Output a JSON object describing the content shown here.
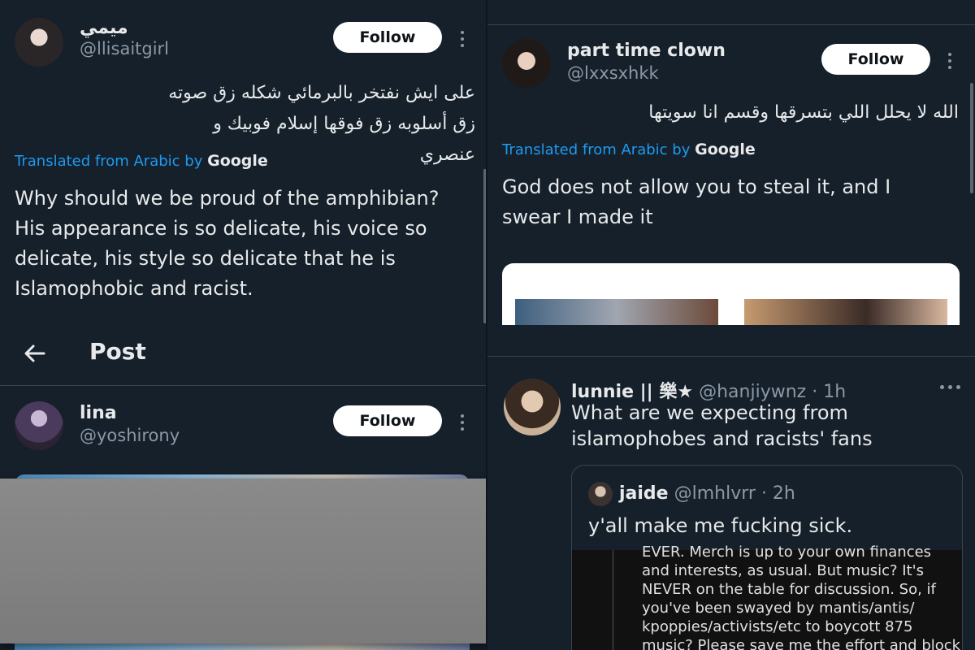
{
  "tweet1": {
    "name": "ميمي",
    "handle": "@llisaitgirl",
    "follow": "Follow",
    "arabic": "على ايش نفتخر بالبرمائي شكله زق صوته زق أسلوبه زق فوقها إسلام فوبيك و عنصري",
    "translated_prefix": "Translated from Arabic by",
    "translated_brand": "Google",
    "english": "Why should we be proud of the amphibian? His appearance is so delicate, his voice so delicate, his style so delicate that he is Islamophobic and racist."
  },
  "header": {
    "title": "Post"
  },
  "tweet2": {
    "name": "lina",
    "handle": "@yoshirony",
    "follow": "Follow"
  },
  "tweet3": {
    "name": "part time clown",
    "handle": "@lxxsxhkk",
    "follow": "Follow",
    "arabic": "الله لا يحلل اللي بتسرقها وقسم انا سويتها",
    "translated_prefix": "Translated from Arabic by",
    "translated_brand": "Google",
    "english": "God does not allow you to steal it, and I swear I made it"
  },
  "tweet4": {
    "name": "lunnie || 樂★",
    "handle": "@hanjiywnz",
    "time": "· 1h",
    "text": "What are we expecting from islamophobes and racists' fans",
    "quote": {
      "name": "jaide",
      "handle": "@lmhlvrr",
      "time": "· 2h",
      "text": "y'all make me fucking sick.",
      "image_lines": [
        "EVER. Merch is up to your own finances",
        "and interests, as usual. But music? It's",
        "NEVER on the table for discussion. So, if",
        "you've been swayed by mantis/antis/",
        "kpoppies/activists/etc to boycott 875",
        "music? Please save me the effort and block"
      ]
    }
  },
  "colors": {
    "background": "#15202b",
    "link": "#1d9bf0",
    "secondary": "#8b98a5",
    "follow_bg": "#ffffff"
  }
}
